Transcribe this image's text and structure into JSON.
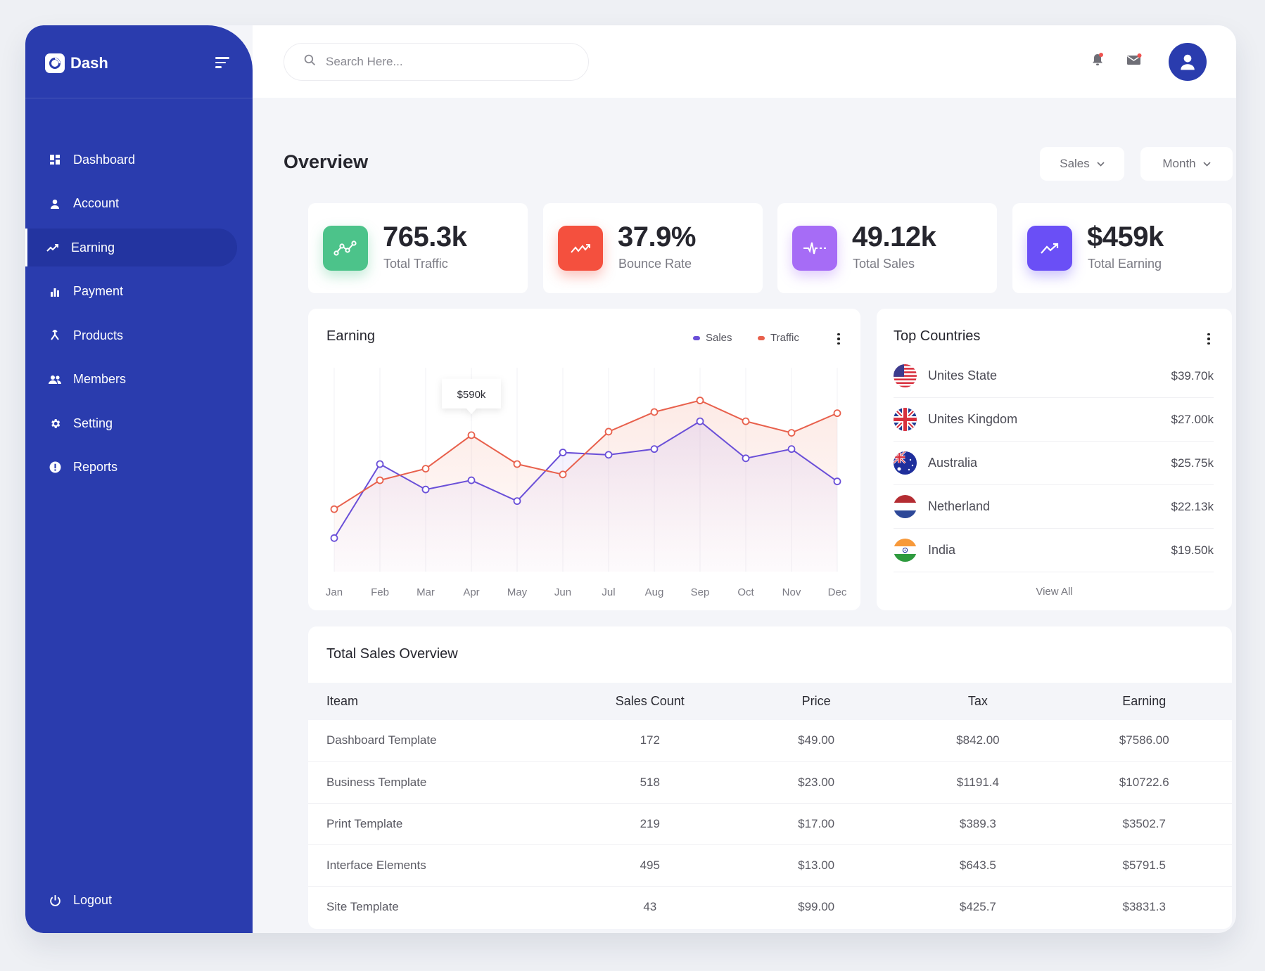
{
  "brand": {
    "name": "Dash"
  },
  "sidebar": {
    "items": [
      {
        "label": "Dashboard",
        "icon": "grid-icon",
        "active": false
      },
      {
        "label": "Account",
        "icon": "user-icon",
        "active": false
      },
      {
        "label": "Earning",
        "icon": "trending-up-icon",
        "active": true
      },
      {
        "label": "Payment",
        "icon": "bar-chart-icon",
        "active": false
      },
      {
        "label": "Products",
        "icon": "merge-icon",
        "active": false
      },
      {
        "label": "Members",
        "icon": "people-icon",
        "active": false
      },
      {
        "label": "Setting",
        "icon": "gear-icon",
        "active": false
      },
      {
        "label": "Reports",
        "icon": "alert-circle-icon",
        "active": false
      }
    ],
    "logout_label": "Logout"
  },
  "header": {
    "search_placeholder": "Search Here...",
    "notification_color": "#ef5350"
  },
  "overview": {
    "title": "Overview",
    "filters": [
      {
        "label": "Sales"
      },
      {
        "label": "Month"
      }
    ]
  },
  "stats": [
    {
      "value": "765.3k",
      "label": "Total Traffic",
      "color": "#4cc38a",
      "icon": "line-points-icon"
    },
    {
      "value": "37.9%",
      "label": "Bounce Rate",
      "color": "#f4503e",
      "icon": "zigzag-arrow-icon"
    },
    {
      "value": "49.12k",
      "label": "Total Sales",
      "color": "#a66cf6",
      "icon": "pulse-icon"
    },
    {
      "value": "$459k",
      "label": "Total Earning",
      "color": "#6a4ff6",
      "icon": "trend-arrow-icon"
    }
  ],
  "earning": {
    "title": "Earning",
    "tooltip": "$590k"
  },
  "chart_data": {
    "type": "area",
    "title": "Earning",
    "categories": [
      "Jan",
      "Feb",
      "Mar",
      "Apr",
      "May",
      "Jun",
      "Jul",
      "Aug",
      "Sep",
      "Oct",
      "Nov",
      "Dec"
    ],
    "series": [
      {
        "name": "Sales",
        "color": "#6a4fd8",
        "values": [
          145,
          465,
          355,
          395,
          305,
          515,
          505,
          530,
          650,
          490,
          530,
          390
        ]
      },
      {
        "name": "Traffic",
        "color": "#e8604c",
        "values": [
          270,
          395,
          445,
          590,
          465,
          420,
          605,
          690,
          740,
          650,
          600,
          685
        ]
      }
    ],
    "highlight": {
      "series": "Traffic",
      "category": "Apr",
      "label": "$590k"
    },
    "ylim": [
      0,
      845
    ],
    "xlabel": "",
    "ylabel": "",
    "grid": "vertical",
    "legend": "top-right"
  },
  "countries": {
    "title": "Top Countries",
    "items": [
      {
        "name": "Unites State",
        "value": "$39.70k",
        "flag": "us"
      },
      {
        "name": "Unites Kingdom",
        "value": "$27.00k",
        "flag": "uk"
      },
      {
        "name": "Australia",
        "value": "$25.75k",
        "flag": "au"
      },
      {
        "name": "Netherland",
        "value": "$22.13k",
        "flag": "nl"
      },
      {
        "name": "India",
        "value": "$19.50k",
        "flag": "in"
      }
    ],
    "view_all": "View All"
  },
  "sales_table": {
    "title": "Total Sales Overview",
    "columns": [
      "Iteam",
      "Sales Count",
      "Price",
      "Tax",
      "Earning"
    ],
    "rows": [
      [
        "Dashboard Template",
        "172",
        "$49.00",
        "$842.00",
        "$7586.00"
      ],
      [
        "Business Template",
        "518",
        "$23.00",
        "$1191.4",
        "$10722.6"
      ],
      [
        "Print Template",
        "219",
        "$17.00",
        "$389.3",
        "$3502.7"
      ],
      [
        "Interface Elements",
        "495",
        "$13.00",
        "$643.5",
        "$5791.5"
      ],
      [
        "Site Template",
        "43",
        "$99.00",
        "$425.7",
        "$3831.3"
      ]
    ]
  }
}
